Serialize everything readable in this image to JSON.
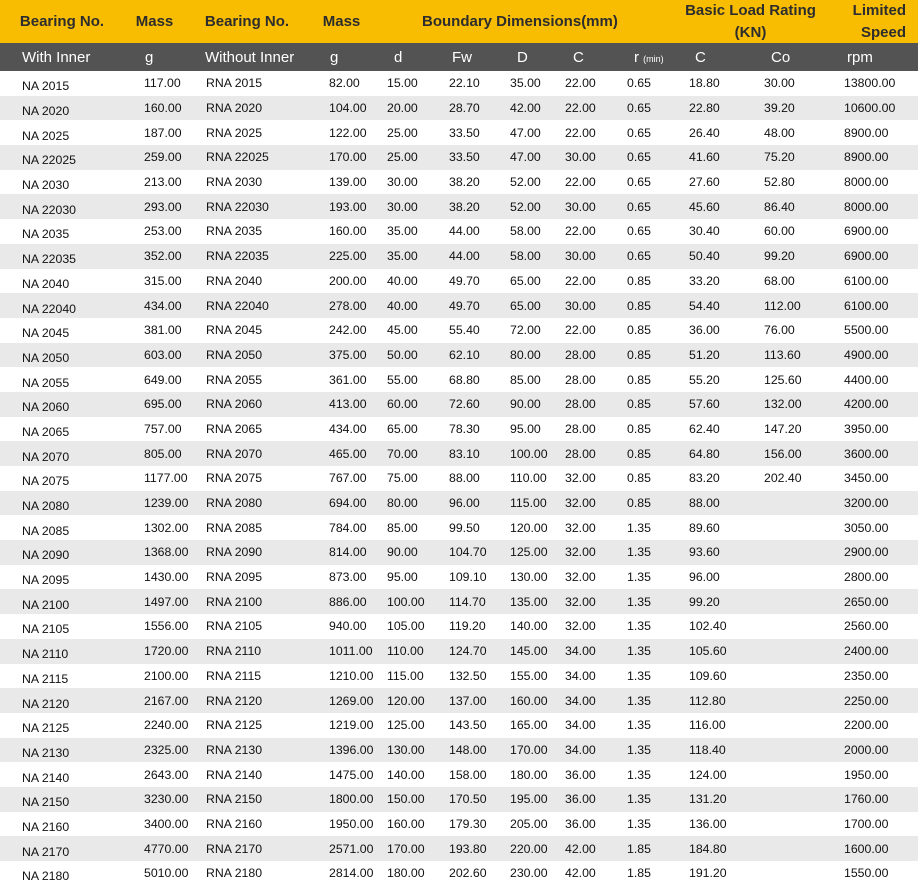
{
  "header": {
    "bearing_no_inner": "Bearing No.",
    "mass_inner": "Mass",
    "bearing_no_noinner": "Bearing No.",
    "mass_noinner": "Mass",
    "boundary": "Boundary Dimensions(mm)",
    "load_line1": "Basic Load Rating",
    "load_line2": "(KN)",
    "speed_line1": "Limited",
    "speed_line2": "Speed"
  },
  "subheader": {
    "with_inner": "With Inner",
    "g1": "g",
    "without_inner": "Without Inner",
    "g2": "g",
    "d": "d",
    "fw": "Fw",
    "D": "D",
    "C": "C",
    "r": "r",
    "rmin": "(min)",
    "C2": "C",
    "Co": "Co",
    "rpm": "rpm"
  },
  "rows": [
    [
      "NA 2015",
      "117.00",
      "RNA 2015",
      "82.00",
      "15.00",
      "22.10",
      "35.00",
      "22.00",
      "0.65",
      "18.80",
      "30.00",
      "13800.00"
    ],
    [
      "NA 2020",
      "160.00",
      "RNA 2020",
      "104.00",
      "20.00",
      "28.70",
      "42.00",
      "22.00",
      "0.65",
      "22.80",
      "39.20",
      "10600.00"
    ],
    [
      "NA 2025",
      "187.00",
      "RNA 2025",
      "122.00",
      "25.00",
      "33.50",
      "47.00",
      "22.00",
      "0.65",
      "26.40",
      "48.00",
      "8900.00"
    ],
    [
      "NA 22025",
      "259.00",
      "RNA 22025",
      "170.00",
      "25.00",
      "33.50",
      "47.00",
      "30.00",
      "0.65",
      "41.60",
      "75.20",
      "8900.00"
    ],
    [
      "NA 2030",
      "213.00",
      "RNA 2030",
      "139.00",
      "30.00",
      "38.20",
      "52.00",
      "22.00",
      "0.65",
      "27.60",
      "52.80",
      "8000.00"
    ],
    [
      "NA 22030",
      "293.00",
      "RNA 22030",
      "193.00",
      "30.00",
      "38.20",
      "52.00",
      "30.00",
      "0.65",
      "45.60",
      "86.40",
      "8000.00"
    ],
    [
      "NA 2035",
      "253.00",
      "RNA 2035",
      "160.00",
      "35.00",
      "44.00",
      "58.00",
      "22.00",
      "0.65",
      "30.40",
      "60.00",
      "6900.00"
    ],
    [
      "NA 22035",
      "352.00",
      "RNA 22035",
      "225.00",
      "35.00",
      "44.00",
      "58.00",
      "30.00",
      "0.65",
      "50.40",
      "99.20",
      "6900.00"
    ],
    [
      "NA 2040",
      "315.00",
      "RNA 2040",
      "200.00",
      "40.00",
      "49.70",
      "65.00",
      "22.00",
      "0.85",
      "33.20",
      "68.00",
      "6100.00"
    ],
    [
      "NA 22040",
      "434.00",
      "RNA 22040",
      "278.00",
      "40.00",
      "49.70",
      "65.00",
      "30.00",
      "0.85",
      "54.40",
      "112.00",
      "6100.00"
    ],
    [
      "NA 2045",
      "381.00",
      "RNA 2045",
      "242.00",
      "45.00",
      "55.40",
      "72.00",
      "22.00",
      "0.85",
      "36.00",
      "76.00",
      "5500.00"
    ],
    [
      "NA 2050",
      "603.00",
      "RNA 2050",
      "375.00",
      "50.00",
      "62.10",
      "80.00",
      "28.00",
      "0.85",
      "51.20",
      "113.60",
      "4900.00"
    ],
    [
      "NA 2055",
      "649.00",
      "RNA 2055",
      "361.00",
      "55.00",
      "68.80",
      "85.00",
      "28.00",
      "0.85",
      "55.20",
      "125.60",
      "4400.00"
    ],
    [
      "NA 2060",
      "695.00",
      "RNA 2060",
      "413.00",
      "60.00",
      "72.60",
      "90.00",
      "28.00",
      "0.85",
      "57.60",
      "132.00",
      "4200.00"
    ],
    [
      "NA 2065",
      "757.00",
      "RNA 2065",
      "434.00",
      "65.00",
      "78.30",
      "95.00",
      "28.00",
      "0.85",
      "62.40",
      "147.20",
      "3950.00"
    ],
    [
      "NA 2070",
      "805.00",
      "RNA 2070",
      "465.00",
      "70.00",
      "83.10",
      "100.00",
      "28.00",
      "0.85",
      "64.80",
      "156.00",
      "3600.00"
    ],
    [
      "NA 2075",
      "1177.00",
      "RNA 2075",
      "767.00",
      "75.00",
      "88.00",
      "110.00",
      "32.00",
      "0.85",
      "83.20",
      "202.40",
      "3450.00"
    ],
    [
      "NA 2080",
      "1239.00",
      "RNA 2080",
      "694.00",
      "80.00",
      "96.00",
      "115.00",
      "32.00",
      "0.85",
      "88.00",
      "",
      "3200.00"
    ],
    [
      "NA 2085",
      "1302.00",
      "RNA 2085",
      "784.00",
      "85.00",
      "99.50",
      "120.00",
      "32.00",
      "1.35",
      "89.60",
      "",
      "3050.00"
    ],
    [
      "NA 2090",
      "1368.00",
      "RNA 2090",
      "814.00",
      "90.00",
      "104.70",
      "125.00",
      "32.00",
      "1.35",
      "93.60",
      "",
      "2900.00"
    ],
    [
      "NA 2095",
      "1430.00",
      "RNA 2095",
      "873.00",
      "95.00",
      "109.10",
      "130.00",
      "32.00",
      "1.35",
      "96.00",
      "",
      "2800.00"
    ],
    [
      "NA 2100",
      "1497.00",
      "RNA 2100",
      "886.00",
      "100.00",
      "114.70",
      "135.00",
      "32.00",
      "1.35",
      "99.20",
      "",
      "2650.00"
    ],
    [
      "NA 2105",
      "1556.00",
      "RNA 2105",
      "940.00",
      "105.00",
      "119.20",
      "140.00",
      "32.00",
      "1.35",
      "102.40",
      "",
      "2560.00"
    ],
    [
      "NA 2110",
      "1720.00",
      "RNA 2110",
      "1011.00",
      "110.00",
      "124.70",
      "145.00",
      "34.00",
      "1.35",
      "105.60",
      "",
      "2400.00"
    ],
    [
      "NA 2115",
      "2100.00",
      "RNA 2115",
      "1210.00",
      "115.00",
      "132.50",
      "155.00",
      "34.00",
      "1.35",
      "109.60",
      "",
      "2350.00"
    ],
    [
      "NA 2120",
      "2167.00",
      "RNA 2120",
      "1269.00",
      "120.00",
      "137.00",
      "160.00",
      "34.00",
      "1.35",
      "112.80",
      "",
      "2250.00"
    ],
    [
      "NA 2125",
      "2240.00",
      "RNA 2125",
      "1219.00",
      "125.00",
      "143.50",
      "165.00",
      "34.00",
      "1.35",
      "116.00",
      "",
      "2200.00"
    ],
    [
      "NA 2130",
      "2325.00",
      "RNA 2130",
      "1396.00",
      "130.00",
      "148.00",
      "170.00",
      "34.00",
      "1.35",
      "118.40",
      "",
      "2000.00"
    ],
    [
      "NA 2140",
      "2643.00",
      "RNA 2140",
      "1475.00",
      "140.00",
      "158.00",
      "180.00",
      "36.00",
      "1.35",
      "124.00",
      "",
      "1950.00"
    ],
    [
      "NA 2150",
      "3230.00",
      "RNA 2150",
      "1800.00",
      "150.00",
      "170.50",
      "195.00",
      "36.00",
      "1.35",
      "131.20",
      "",
      "1760.00"
    ],
    [
      "NA 2160",
      "3400.00",
      "RNA 2160",
      "1950.00",
      "160.00",
      "179.30",
      "205.00",
      "36.00",
      "1.35",
      "136.00",
      "",
      "1700.00"
    ],
    [
      "NA 2170",
      "4770.00",
      "RNA 2170",
      "2571.00",
      "170.00",
      "193.80",
      "220.00",
      "42.00",
      "1.85",
      "184.80",
      "",
      "1600.00"
    ],
    [
      "NA 2180",
      "5010.00",
      "RNA 2180",
      "2814.00",
      "180.00",
      "202.60",
      "230.00",
      "42.00",
      "1.85",
      "191.20",
      "",
      "1550.00"
    ]
  ]
}
